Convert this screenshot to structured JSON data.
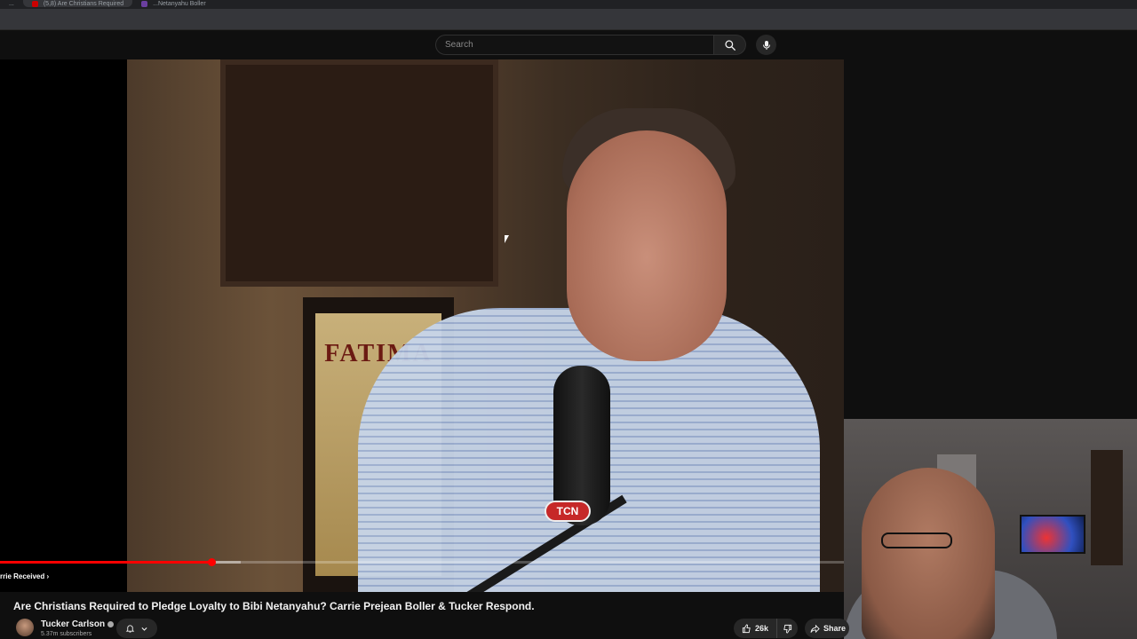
{
  "browser": {
    "tabs": [
      {
        "label": "..."
      },
      {
        "label": "(5,8) Are Christians Required"
      },
      {
        "label": "...Netanyahu Boller"
      }
    ]
  },
  "header": {
    "search_placeholder": "Search"
  },
  "player": {
    "poster_text": "FATIMA",
    "mic_logo": "TCN",
    "chapter_label": "rrie Received",
    "progress": {
      "played_fraction": 0.25,
      "loaded_fraction": 0.285
    }
  },
  "video": {
    "title": "Are Christians Required to Pledge Loyalty to Bibi Netanyahu? Carrie Prejean Boller & Tucker Respond.",
    "channel_name": "Tucker Carlson",
    "subscribers": "5.37m subscribers",
    "likes": "26k",
    "share_label": "Share"
  },
  "colors": {
    "accent": "#ff0000",
    "background": "#0f0f0f"
  }
}
